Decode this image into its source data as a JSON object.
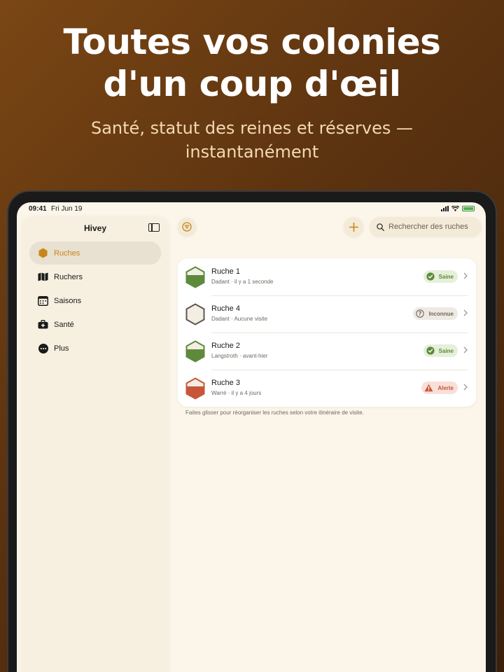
{
  "headline": [
    "Toutes vos colonies",
    "d'un coup d'œil"
  ],
  "subheadline": [
    "Santé, statut des reines et réserves —",
    "instantanément"
  ],
  "status_bar": {
    "time": "09:41",
    "date": "Fri Jun 19"
  },
  "sidebar": {
    "title": "Hivey",
    "items": [
      {
        "label": "Ruches",
        "icon": "hexagon-icon",
        "active": true
      },
      {
        "label": "Ruchers",
        "icon": "map-icon",
        "active": false
      },
      {
        "label": "Saisons",
        "icon": "calendar-icon",
        "active": false
      },
      {
        "label": "Santé",
        "icon": "medical-kit-icon",
        "active": false
      },
      {
        "label": "Plus",
        "icon": "more-icon",
        "active": false
      }
    ]
  },
  "toolbar": {
    "search_placeholder": "Rechercher des ruches"
  },
  "hives": [
    {
      "name": "Ruche 1",
      "type": "Dadant",
      "last_visit": "il y a 1 seconde",
      "status": "Saine",
      "status_kind": "healthy",
      "fill": 0.55
    },
    {
      "name": "Ruche 4",
      "type": "Dadant",
      "last_visit": "Aucune visite",
      "status": "Inconnue",
      "status_kind": "unknown",
      "fill": 0
    },
    {
      "name": "Ruche 2",
      "type": "Langstroth",
      "last_visit": "avant-hier",
      "status": "Saine",
      "status_kind": "healthy",
      "fill": 0.55
    },
    {
      "name": "Ruche 3",
      "type": "Warré",
      "last_visit": "il y a 4 jours",
      "status": "Alerte",
      "status_kind": "alert",
      "fill": 0.55
    }
  ],
  "footer_note": "Faites glisser pour réorganiser les ruches selon votre itinéraire de visite.",
  "colors": {
    "accent": "#c8861a",
    "healthy": "#5e8a3c",
    "healthy_bg": "#e6efd9",
    "unknown": "#6f6a60",
    "unknown_bg": "#eeeae2",
    "alert": "#c8553a",
    "alert_bg": "#f8e0d8"
  }
}
